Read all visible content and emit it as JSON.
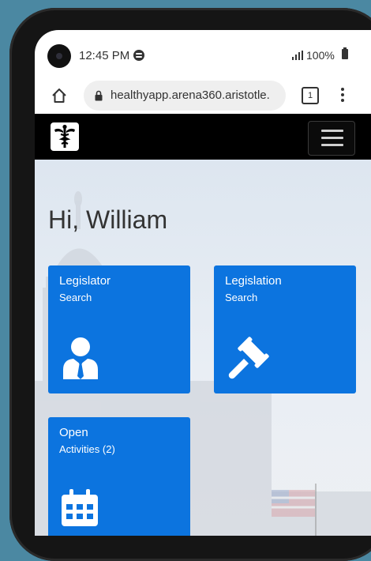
{
  "status_bar": {
    "time": "12:45 PM",
    "battery": "100%",
    "icons": [
      "camera-icon",
      "spotify-icon",
      "signal-icon",
      "battery-icon"
    ]
  },
  "browser": {
    "url": "healthyapp.arena360.aristotle.",
    "tab_count": "1",
    "icons": [
      "home-icon",
      "lock-icon",
      "tabs-icon",
      "more-vert-icon"
    ]
  },
  "app_header": {
    "logo_icon": "caduceus-logo-icon",
    "menu_icon": "hamburger-menu-icon"
  },
  "main": {
    "greeting": "Hi, William",
    "tiles": [
      {
        "title": "Legislator",
        "subtitle": "Search",
        "icon": "person-tie-icon"
      },
      {
        "title": "Legislation",
        "subtitle": "Search",
        "icon": "gavel-icon"
      },
      {
        "title": "Open",
        "subtitle": "Activities (2)",
        "icon": "calendar-icon"
      }
    ]
  },
  "colors": {
    "tile_blue": "#0c74df",
    "header_black": "#000000",
    "page_background": "#4b88a2"
  }
}
